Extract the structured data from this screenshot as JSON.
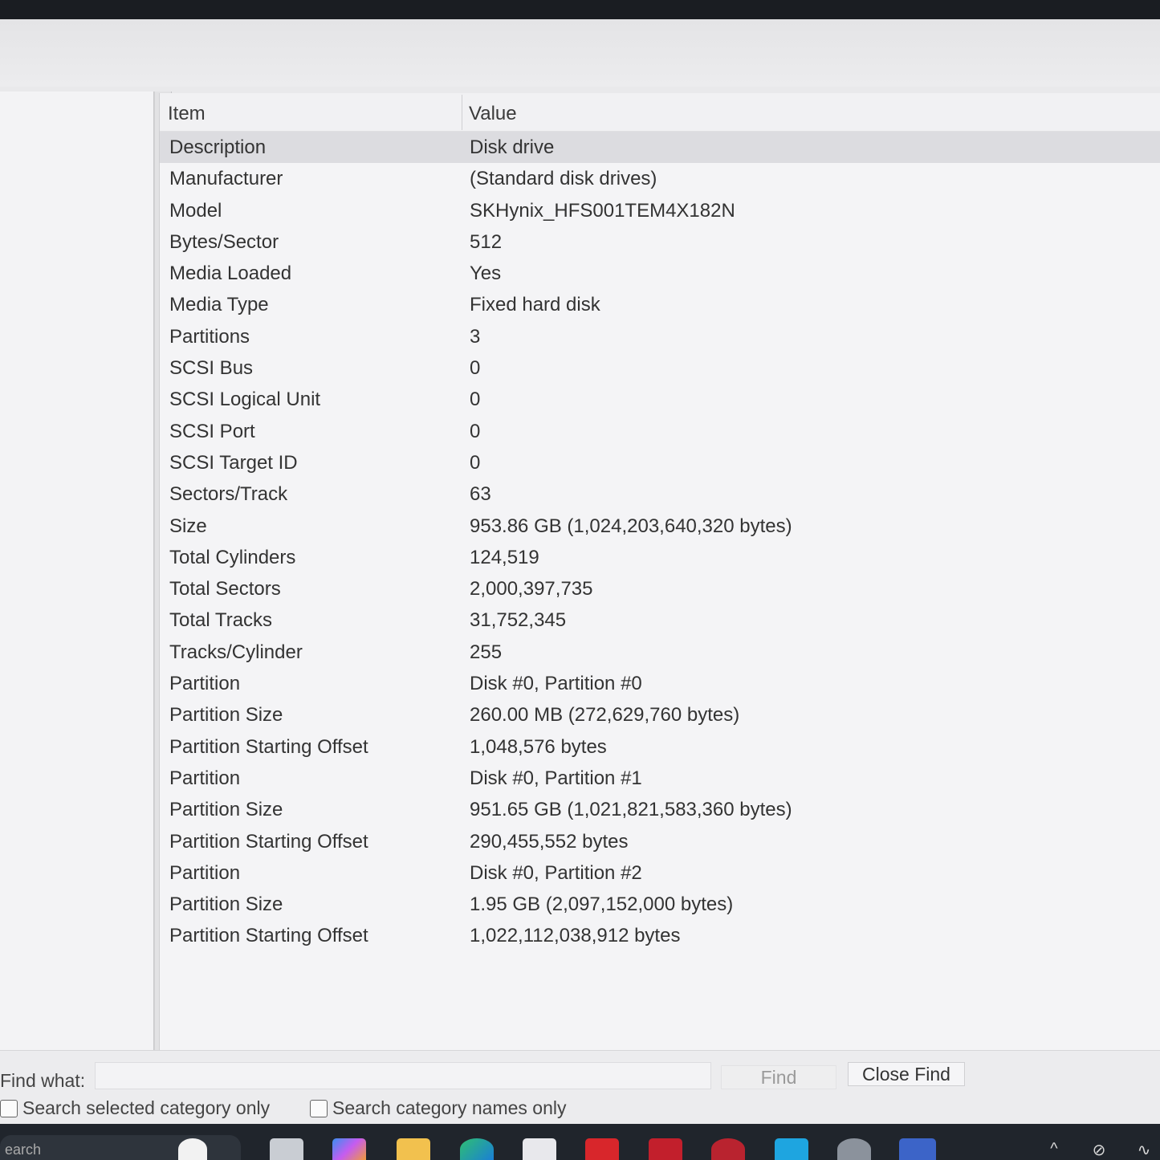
{
  "list": {
    "headers": {
      "item": "Item",
      "value": "Value"
    },
    "rows": [
      {
        "item": "Description",
        "value": "Disk drive"
      },
      {
        "item": "Manufacturer",
        "value": "(Standard disk drives)"
      },
      {
        "item": "Model",
        "value": "SKHynix_HFS001TEM4X182N"
      },
      {
        "item": "Bytes/Sector",
        "value": "512"
      },
      {
        "item": "Media Loaded",
        "value": "Yes"
      },
      {
        "item": "Media Type",
        "value": "Fixed hard disk"
      },
      {
        "item": "Partitions",
        "value": "3"
      },
      {
        "item": "SCSI Bus",
        "value": "0"
      },
      {
        "item": "SCSI Logical Unit",
        "value": "0"
      },
      {
        "item": "SCSI Port",
        "value": "0"
      },
      {
        "item": "SCSI Target ID",
        "value": "0"
      },
      {
        "item": "Sectors/Track",
        "value": "63"
      },
      {
        "item": "Size",
        "value": "953.86 GB (1,024,203,640,320 bytes)"
      },
      {
        "item": "Total Cylinders",
        "value": "124,519"
      },
      {
        "item": "Total Sectors",
        "value": "2,000,397,735"
      },
      {
        "item": "Total Tracks",
        "value": "31,752,345"
      },
      {
        "item": "Tracks/Cylinder",
        "value": "255"
      },
      {
        "item": "Partition",
        "value": "Disk #0, Partition #0"
      },
      {
        "item": "Partition Size",
        "value": "260.00 MB (272,629,760 bytes)"
      },
      {
        "item": "Partition Starting Offset",
        "value": "1,048,576 bytes"
      },
      {
        "item": "Partition",
        "value": "Disk #0, Partition #1"
      },
      {
        "item": "Partition Size",
        "value": "951.65 GB (1,021,821,583,360 bytes)"
      },
      {
        "item": "Partition Starting Offset",
        "value": "290,455,552 bytes"
      },
      {
        "item": "Partition",
        "value": "Disk #0, Partition #2"
      },
      {
        "item": "Partition Size",
        "value": "1.95 GB (2,097,152,000 bytes)"
      },
      {
        "item": "Partition Starting Offset",
        "value": "1,022,112,038,912 bytes"
      }
    ],
    "selected_index": 0
  },
  "find": {
    "label": "Find what:",
    "input_value": "",
    "find_button": "Find",
    "close_button": "Close Find",
    "search_selected_label": "Search selected category only",
    "search_names_label": "Search category names only"
  },
  "taskbar": {
    "search_text": "earch",
    "icons": [
      "soccer-ball-icon",
      "app-icon",
      "copilot-icon",
      "file-explorer-icon",
      "edge-icon",
      "store-icon",
      "office-icon",
      "mcafee-icon",
      "shopping-bag-icon",
      "photos-icon",
      "settings-icon",
      "system-information-icon"
    ],
    "tray_icons": [
      "chevron-up-icon",
      "network-off-icon",
      "wifi-icon"
    ]
  },
  "colors": {
    "selection": "#dcdce0",
    "window_bg": "#e9e9eb",
    "taskbar_bg": "#20252c"
  }
}
